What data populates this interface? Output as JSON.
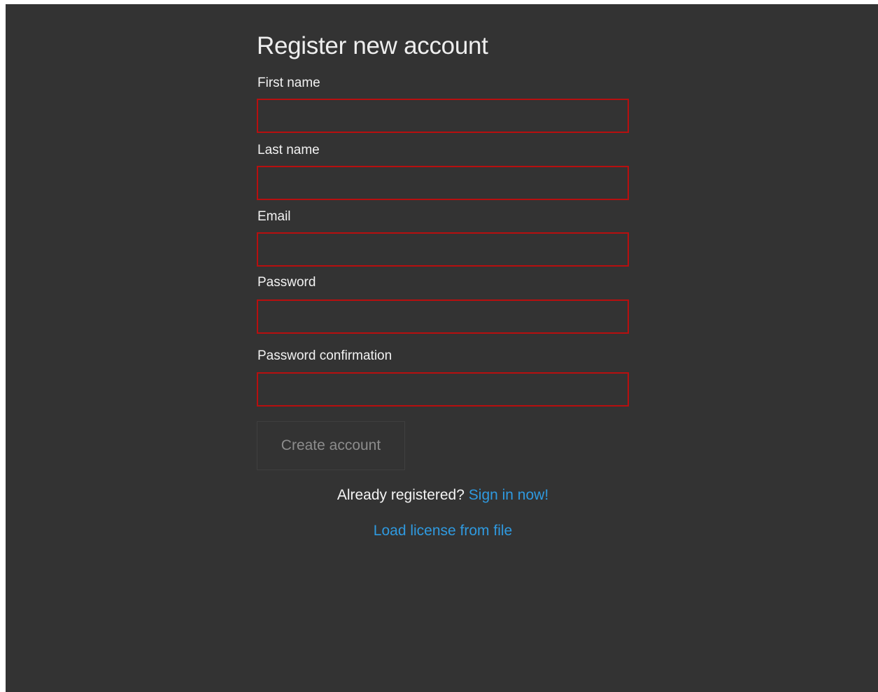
{
  "register": {
    "title": "Register new account",
    "fields": {
      "first_name": {
        "label": "First name",
        "value": ""
      },
      "last_name": {
        "label": "Last name",
        "value": ""
      },
      "email": {
        "label": "Email",
        "value": ""
      },
      "password": {
        "label": "Password",
        "value": ""
      },
      "password_confirmation": {
        "label": "Password confirmation",
        "value": ""
      }
    },
    "create_button_label": "Create account",
    "already_registered_text": "Already registered?",
    "sign_in_link": "Sign in now!",
    "load_license_link": "Load license from file"
  },
  "colors": {
    "background": "#333333",
    "invalid_border": "#b80f0f",
    "link": "#2f9ae0",
    "disabled_text": "#8c8c8c"
  }
}
